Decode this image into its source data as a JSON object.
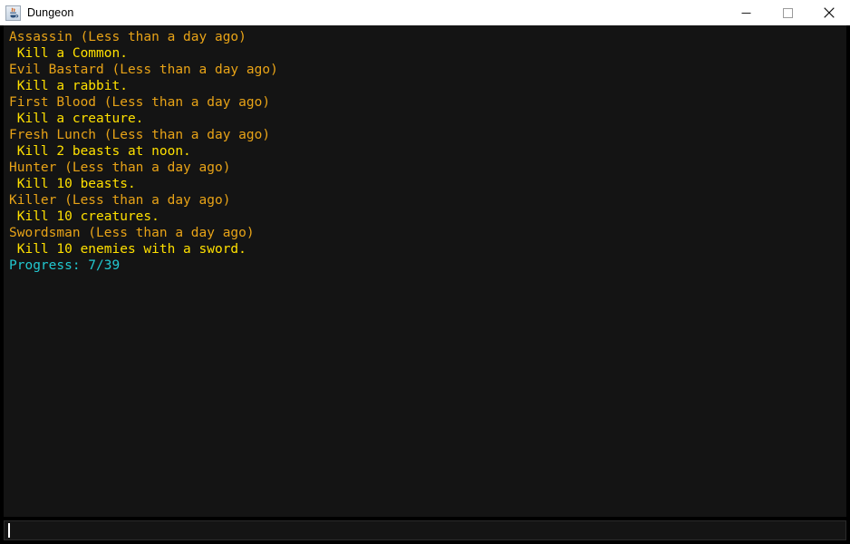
{
  "window": {
    "title": "Dungeon",
    "app_icon": "java-coffee-cup-icon",
    "controls": {
      "minimize": "minimize-icon",
      "maximize": "maximize-icon",
      "close": "close-icon"
    }
  },
  "colors": {
    "titlebar_bg": "#ffffff",
    "titlebar_fg": "#000000",
    "window_border": "#000000",
    "console_bg": "#141414",
    "achievement_title": "#e8a317",
    "achievement_desc": "#ffe000",
    "progress": "#22c8d0",
    "caret": "#ffffff"
  },
  "console": {
    "achievements": [
      {
        "name": "Assassin",
        "age": "(Less than a day ago)",
        "description": " Kill a Common."
      },
      {
        "name": "Evil Bastard",
        "age": "(Less than a day ago)",
        "description": " Kill a rabbit."
      },
      {
        "name": "First Blood",
        "age": "(Less than a day ago)",
        "description": " Kill a creature."
      },
      {
        "name": "Fresh Lunch",
        "age": "(Less than a day ago)",
        "description": " Kill 2 beasts at noon."
      },
      {
        "name": "Hunter",
        "age": "(Less than a day ago)",
        "description": " Kill 10 beasts."
      },
      {
        "name": "Killer",
        "age": "(Less than a day ago)",
        "description": " Kill 10 creatures."
      },
      {
        "name": "Swordsman",
        "age": "(Less than a day ago)",
        "description": " Kill 10 enemies with a sword."
      }
    ],
    "progress_label": "Progress:",
    "progress_value": "7/39",
    "progress_line": "Progress: 7/39"
  },
  "input": {
    "value": "",
    "placeholder": ""
  }
}
